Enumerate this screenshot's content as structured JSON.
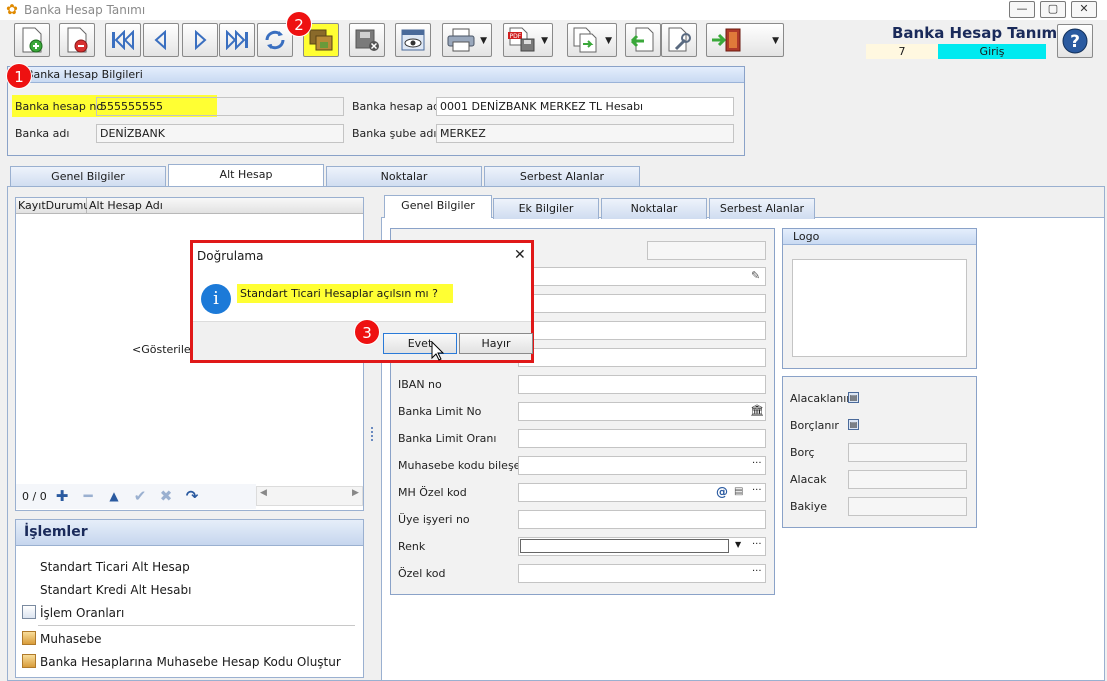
{
  "window": {
    "title": "Banka Hesap Tanımı",
    "minimize": "—",
    "maximize": "▢",
    "close": "✕"
  },
  "header": {
    "title": "Banka Hesap Tanımı",
    "record_no": "7",
    "mode": "Giriş"
  },
  "account_info": {
    "group_title": "Banka Hesap Bilgileri",
    "account_no_label": "Banka hesap no",
    "account_no_value": "555555555",
    "account_name_label": "Banka hesap adı",
    "account_name_value": "0001 DENİZBANK MERKEZ TL Hesabı",
    "bank_name_label": "Banka adı",
    "bank_name_value": "DENİZBANK",
    "branch_name_label": "Banka şube adı",
    "branch_name_value": "MERKEZ"
  },
  "main_tabs": [
    "Genel Bilgiler",
    "Alt Hesap",
    "Noktalar",
    "Serbest Alanlar"
  ],
  "sub_grid": {
    "columns": [
      "KayıtDurumu",
      "Alt Hesap Adı"
    ],
    "empty_text": "<Gösterilec",
    "counter": "0 / 0"
  },
  "operations": {
    "title": "İşlemler",
    "items": [
      "Standart Ticari Alt Hesap",
      "Standart Kredi Alt Hesabı",
      "İşlem Oranları",
      "Muhasebe",
      "Banka Hesaplarına Muhasebe Hesap Kodu Oluştur"
    ]
  },
  "detail_tabs": [
    "Genel Bilgiler",
    "Ek Bilgiler",
    "Noktalar",
    "Serbest Alanlar"
  ],
  "detail_fields": {
    "iban": "IBAN no",
    "limit_no": "Banka Limit No",
    "limit_rate": "Banka Limit Oranı",
    "acc_code": "Muhasebe kodu bileşeni",
    "mh_code": "MH Özel kod",
    "member_no": "Üye işyeri no",
    "color": "Renk",
    "special_code": "Özel kod"
  },
  "logo": {
    "title": "Logo"
  },
  "balance": {
    "receivables": "Alacaklanır",
    "payables": "Borçlanır",
    "debit": "Borç",
    "credit": "Alacak",
    "balance": "Bakiye"
  },
  "dialog": {
    "title": "Doğrulama",
    "close": "✕",
    "message": "Standart Ticari Hesaplar açılsın mı ?",
    "yes": "Evet",
    "no": "Hayır"
  },
  "markers": [
    "1",
    "2",
    "3"
  ],
  "colors": {
    "highlight": "#ffff33",
    "marker": "#ee1111",
    "mode_badge": "#00eaf0",
    "title_text": "#1a2a5a",
    "accent": "#1c7ad8"
  }
}
